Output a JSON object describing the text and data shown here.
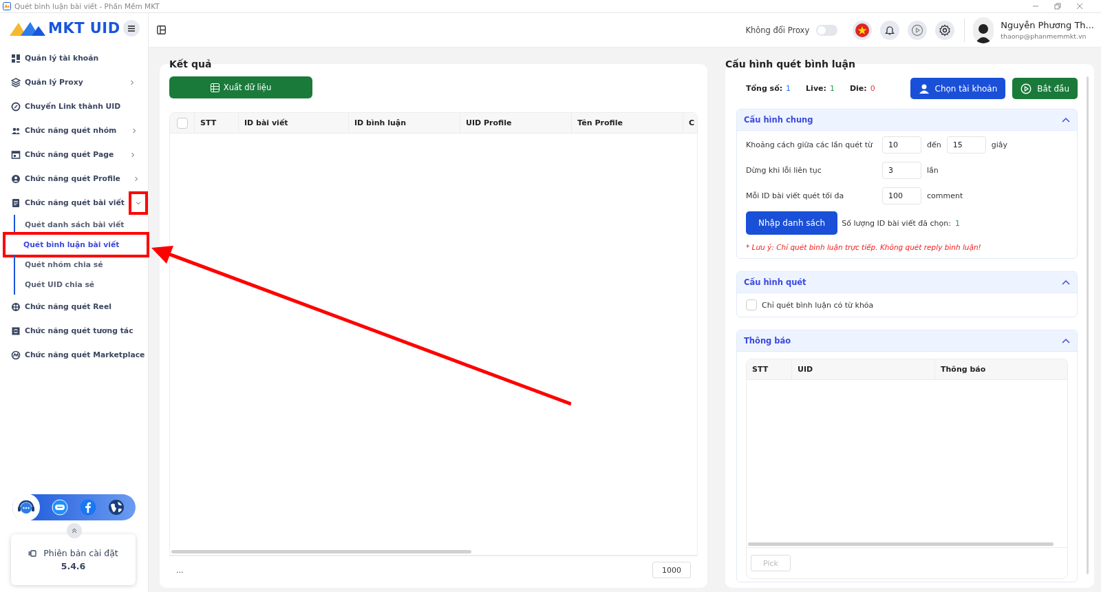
{
  "window": {
    "title": "Quét bình luận bài viết - Phần Mềm MKT"
  },
  "sidebar": {
    "logo": "MKT UID",
    "items": [
      {
        "label": "Quản lý tài khoản"
      },
      {
        "label": "Quản lý Proxy",
        "expanded": false
      },
      {
        "label": "Chuyển Link thành UID"
      },
      {
        "label": "Chức năng quét nhóm",
        "expanded": false
      },
      {
        "label": "Chức năng quét Page",
        "expanded": false
      },
      {
        "label": "Chức năng quét Profile",
        "expanded": false
      },
      {
        "label": "Chức năng quét bài viết",
        "expanded": true,
        "chevron_outlined": true,
        "children": [
          {
            "label": "Quét danh sách bài viết",
            "selected": false,
            "outlined": false
          },
          {
            "label": "Quét bình luận bài viết",
            "selected": true,
            "outlined": true
          },
          {
            "label": "Quét nhóm chia sẻ",
            "selected": false,
            "outlined": false
          },
          {
            "label": "Quét UID chia sẻ",
            "selected": false,
            "outlined": false
          }
        ]
      },
      {
        "label": "Chức năng quét Reel"
      },
      {
        "label": "Chức năng quét tương tác"
      },
      {
        "label": "Chức năng quét Marketplace"
      }
    ],
    "version": {
      "label": "Phiên bản cài đặt",
      "number": "5.4.6"
    }
  },
  "header": {
    "proxy_label": "Không đổi Proxy",
    "proxy_on": false,
    "user_name": "Nguyễn Phương Th...",
    "user_email": "thaonp@phanmemmkt.vn"
  },
  "results": {
    "title": "Kết quả",
    "export_button": "Xuất dữ liệu",
    "select_all_checked": false,
    "columns": [
      "STT",
      "ID bài viết",
      "ID bình luận",
      "UID Profile",
      "Tên Profile",
      "C"
    ],
    "footer_text": "...",
    "page_size": "1000"
  },
  "config": {
    "title": "Cấu hình quét bình luận",
    "stats": [
      {
        "label": "Tổng số:",
        "value": "1",
        "color": "#1a73e8"
      },
      {
        "label": "Live:",
        "value": "1",
        "color": "#1e9e4a"
      },
      {
        "label": "Die:",
        "value": "0",
        "color": "#e53935"
      }
    ],
    "choose_button": "Chọn tài khoản",
    "start_button": "Bắt đầu",
    "general": {
      "title": "Cấu hình chung",
      "expanded": true,
      "rows": [
        {
          "label": "Khoảng cách giữa các lần quét từ",
          "parts": [
            {
              "kind": "input",
              "value": "10"
            },
            {
              "kind": "text",
              "text": "đến"
            },
            {
              "kind": "input",
              "value": "15"
            },
            {
              "kind": "text",
              "text": "giây"
            }
          ]
        },
        {
          "label": "Dừng khi lỗi liên tục",
          "parts": [
            {
              "kind": "input",
              "value": "3"
            },
            {
              "kind": "text",
              "text": "lần"
            }
          ]
        },
        {
          "label": "Mỗi ID bài viết quét tối đa",
          "parts": [
            {
              "kind": "input",
              "value": "100"
            },
            {
              "kind": "text",
              "text": "comment"
            }
          ]
        }
      ],
      "import_button": "Nhập danh sách",
      "count_label": "Số lượng ID bài viết đã chọn:",
      "count": "1",
      "note": "* Lưu ý: Chỉ quét bình luận trực tiếp. Không quét reply bình luận!"
    },
    "scan": {
      "title": "Cấu hình quét",
      "expanded": true,
      "checkbox_label": "Chỉ quét bình luận có từ khóa",
      "checked": false
    },
    "notify": {
      "title": "Thông báo",
      "expanded": true,
      "columns": [
        "STT",
        "UID",
        "Thông báo"
      ],
      "pick_button": "Pick",
      "pick_disabled": true
    }
  },
  "annotation_arrow": true
}
